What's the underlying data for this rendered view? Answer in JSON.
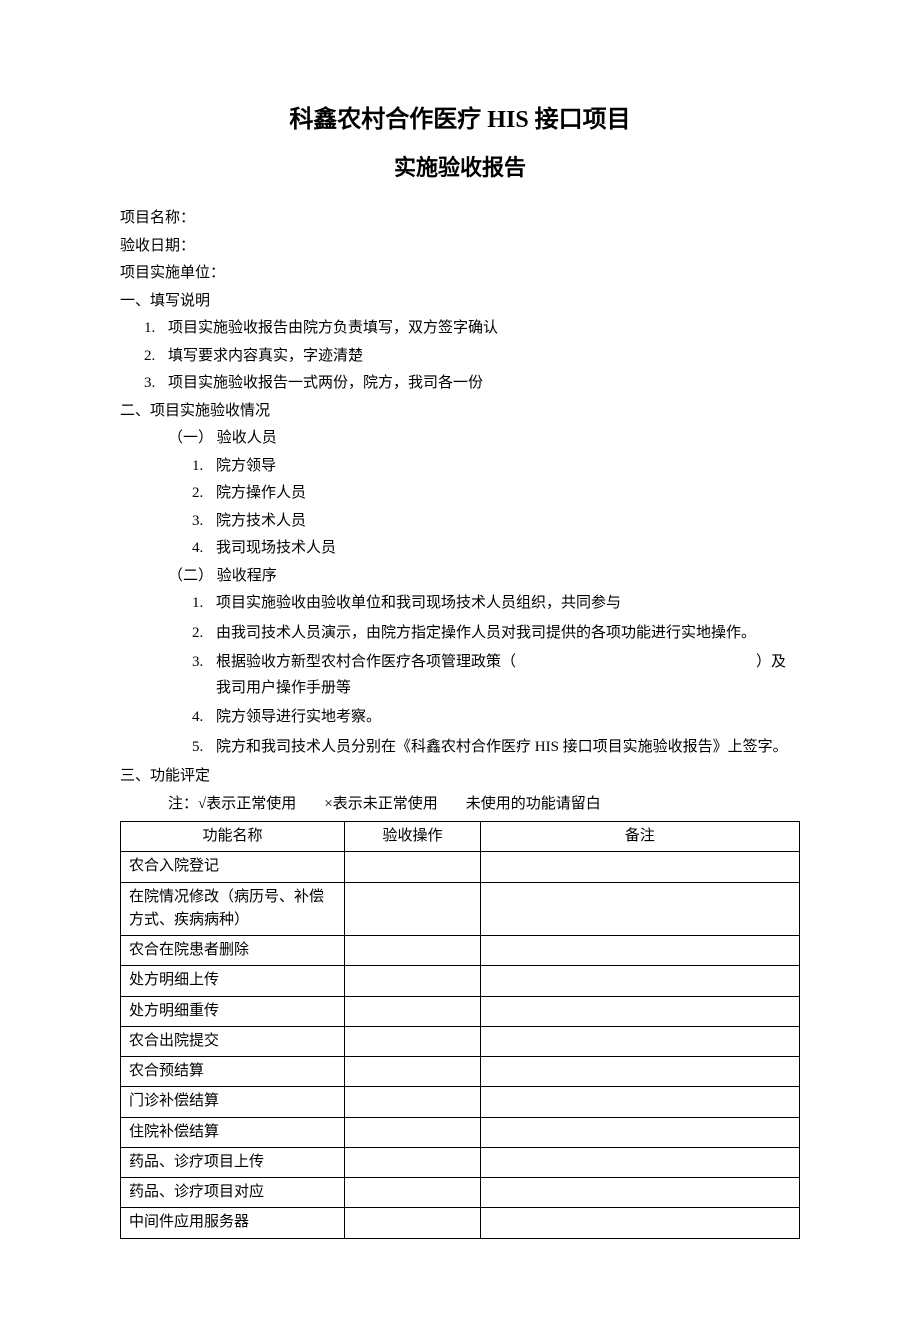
{
  "title_line1": "科鑫农村合作医疗 HIS 接口项目",
  "title_line2": "实施验收报告",
  "fields": {
    "project_name_label": "项目名称：",
    "accept_date_label": "验收日期：",
    "impl_unit_label": "项目实施单位："
  },
  "section1": {
    "header": "一、填写说明",
    "items": [
      "项目实施验收报告由院方负责填写，双方签字确认",
      "填写要求内容真实，字迹清楚",
      "项目实施验收报告一式两份，院方，我司各一份"
    ]
  },
  "section2": {
    "header": "二、项目实施验收情况",
    "sub1": {
      "header": "（一） 验收人员",
      "items": [
        "院方领导",
        "院方操作人员",
        "院方技术人员",
        "我司现场技术人员"
      ]
    },
    "sub2": {
      "header": "（二） 验收程序",
      "items": [
        "项目实施验收由验收单位和我司现场技术人员组织，共同参与",
        "由我司技术人员演示，由院方指定操作人员对我司提供的各项功能进行实地操作。",
        "根据验收方新型农村合作医疗各项管理政策（　　　　　　　　　　　　　　　　）及我司用户操作手册等",
        "院方领导进行实地考察。",
        "院方和我司技术人员分别在《科鑫农村合作医疗 HIS 接口项目实施验收报告》上签字。"
      ]
    }
  },
  "section3": {
    "header": "三、功能评定",
    "note": {
      "prefix": "注：",
      "a": "√表示正常使用",
      "b": "×表示未正常使用",
      "c": "未使用的功能请留白"
    },
    "table": {
      "headers": [
        "功能名称",
        "验收操作",
        "备注"
      ],
      "rows": [
        {
          "name": "农合入院登记",
          "op": "",
          "remark": ""
        },
        {
          "name": "在院情况修改（病历号、补偿方式、疾病病种）",
          "op": "",
          "remark": ""
        },
        {
          "name": "农合在院患者删除",
          "op": "",
          "remark": ""
        },
        {
          "name": "处方明细上传",
          "op": "",
          "remark": ""
        },
        {
          "name": "处方明细重传",
          "op": "",
          "remark": ""
        },
        {
          "name": "农合出院提交",
          "op": "",
          "remark": ""
        },
        {
          "name": "农合预结算",
          "op": "",
          "remark": ""
        },
        {
          "name": "门诊补偿结算",
          "op": "",
          "remark": ""
        },
        {
          "name": "住院补偿结算",
          "op": "",
          "remark": ""
        },
        {
          "name": "药品、诊疗项目上传",
          "op": "",
          "remark": ""
        },
        {
          "name": "药品、诊疗项目对应",
          "op": "",
          "remark": ""
        },
        {
          "name": "中间件应用服务器",
          "op": "",
          "remark": ""
        }
      ]
    }
  }
}
